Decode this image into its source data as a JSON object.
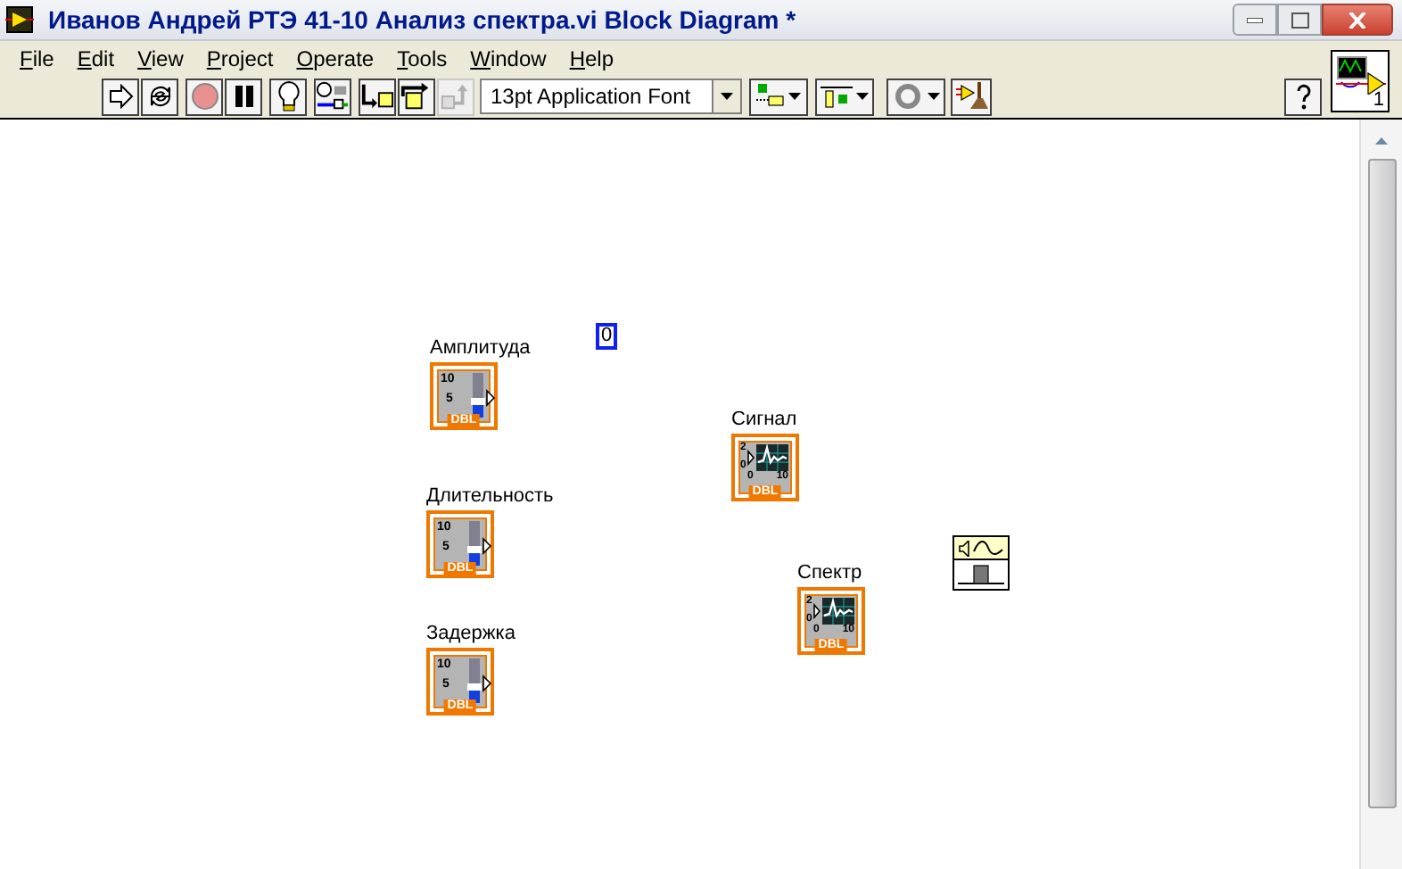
{
  "window": {
    "title": "Иванов Андрей РТЭ 41-10 Анализ спектра.vi Block Diagram *"
  },
  "menu": [
    "File",
    "Edit",
    "View",
    "Project",
    "Operate",
    "Tools",
    "Window",
    "Help"
  ],
  "toolbar": {
    "buttons": [
      {
        "kind": "run",
        "disabled": false
      },
      {
        "kind": "run-continuous",
        "disabled": false
      },
      {
        "kind": "abort",
        "disabled": false
      },
      {
        "kind": "pause",
        "disabled": false
      },
      {
        "kind": "highlight",
        "disabled": false
      },
      {
        "kind": "retain",
        "disabled": false
      },
      {
        "kind": "step-into",
        "disabled": false
      },
      {
        "kind": "step-over",
        "disabled": false
      },
      {
        "kind": "step-out",
        "disabled": true
      }
    ],
    "font": "13pt Application Font",
    "connector_count": "1"
  },
  "diagram": {
    "constant": "0",
    "terminals": [
      {
        "kind": "slider",
        "label": "Амплитуда",
        "type": "DBL",
        "scale": [
          "10",
          "5"
        ]
      },
      {
        "kind": "slider",
        "label": "Длительность",
        "type": "DBL",
        "scale": [
          "10",
          "5"
        ]
      },
      {
        "kind": "slider",
        "label": "Задержка",
        "type": "DBL",
        "scale": [
          "10",
          "5"
        ]
      },
      {
        "kind": "graph",
        "label": "Сигнал",
        "type": "DBL",
        "scale": [
          "2",
          "0",
          "0",
          "10"
        ]
      },
      {
        "kind": "graph",
        "label": "Спектр",
        "type": "DBL",
        "scale": [
          "2",
          "0",
          "0",
          "10"
        ]
      }
    ]
  }
}
